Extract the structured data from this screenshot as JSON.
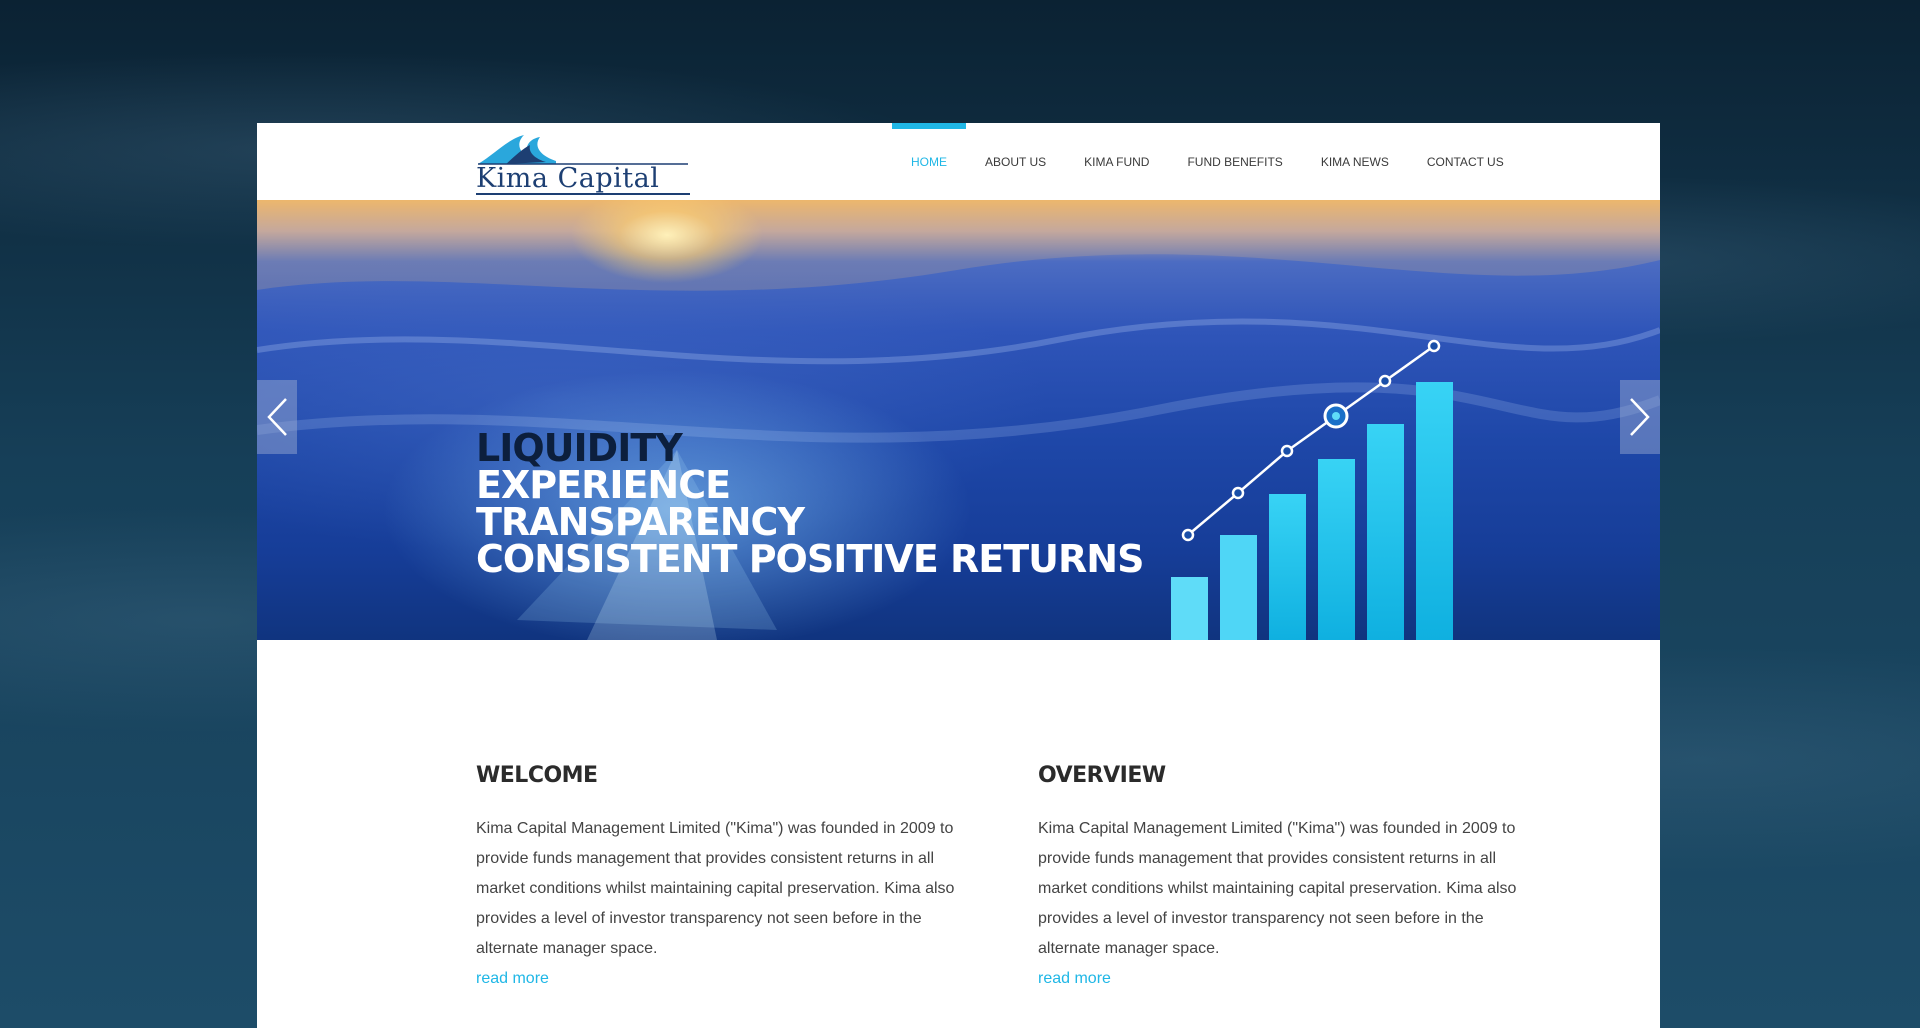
{
  "header": {
    "logo_text": "Kima Capital",
    "nav": [
      {
        "label": "HOME",
        "active": true
      },
      {
        "label": "ABOUT US",
        "active": false
      },
      {
        "label": "KIMA FUND",
        "active": false
      },
      {
        "label": "FUND BENEFITS",
        "active": false
      },
      {
        "label": "KIMA NEWS",
        "active": false
      },
      {
        "label": "CONTACT US",
        "active": false
      }
    ]
  },
  "hero": {
    "lines": [
      "LIQUIDITY",
      "EXPERIENCE",
      "TRANSPARENCY",
      "CONSISTENT POSITIVE RETURNS"
    ],
    "prev_icon": "chevron-left-icon",
    "next_icon": "chevron-right-icon"
  },
  "welcome": {
    "title": "WELCOME",
    "body": "Kima Capital Management Limited (\"Kima\") was founded in 2009 to provide funds management that provides consistent returns in all market conditions whilst maintaining capital preservation. Kima also provides a level of investor transparency not seen before in the alternate manager space.",
    "link": "read more"
  },
  "overview": {
    "title": "OVERVIEW",
    "body": "Kima Capital Management Limited (\"Kima\") was founded in 2009 to provide funds management that provides consistent returns in all market conditions whilst maintaining capital preservation. Kima also provides a level of investor transparency not seen before in the alternate manager space.",
    "link": "read more"
  },
  "colors": {
    "accent": "#1fb7e6",
    "logo_navy": "#1d3f73"
  }
}
